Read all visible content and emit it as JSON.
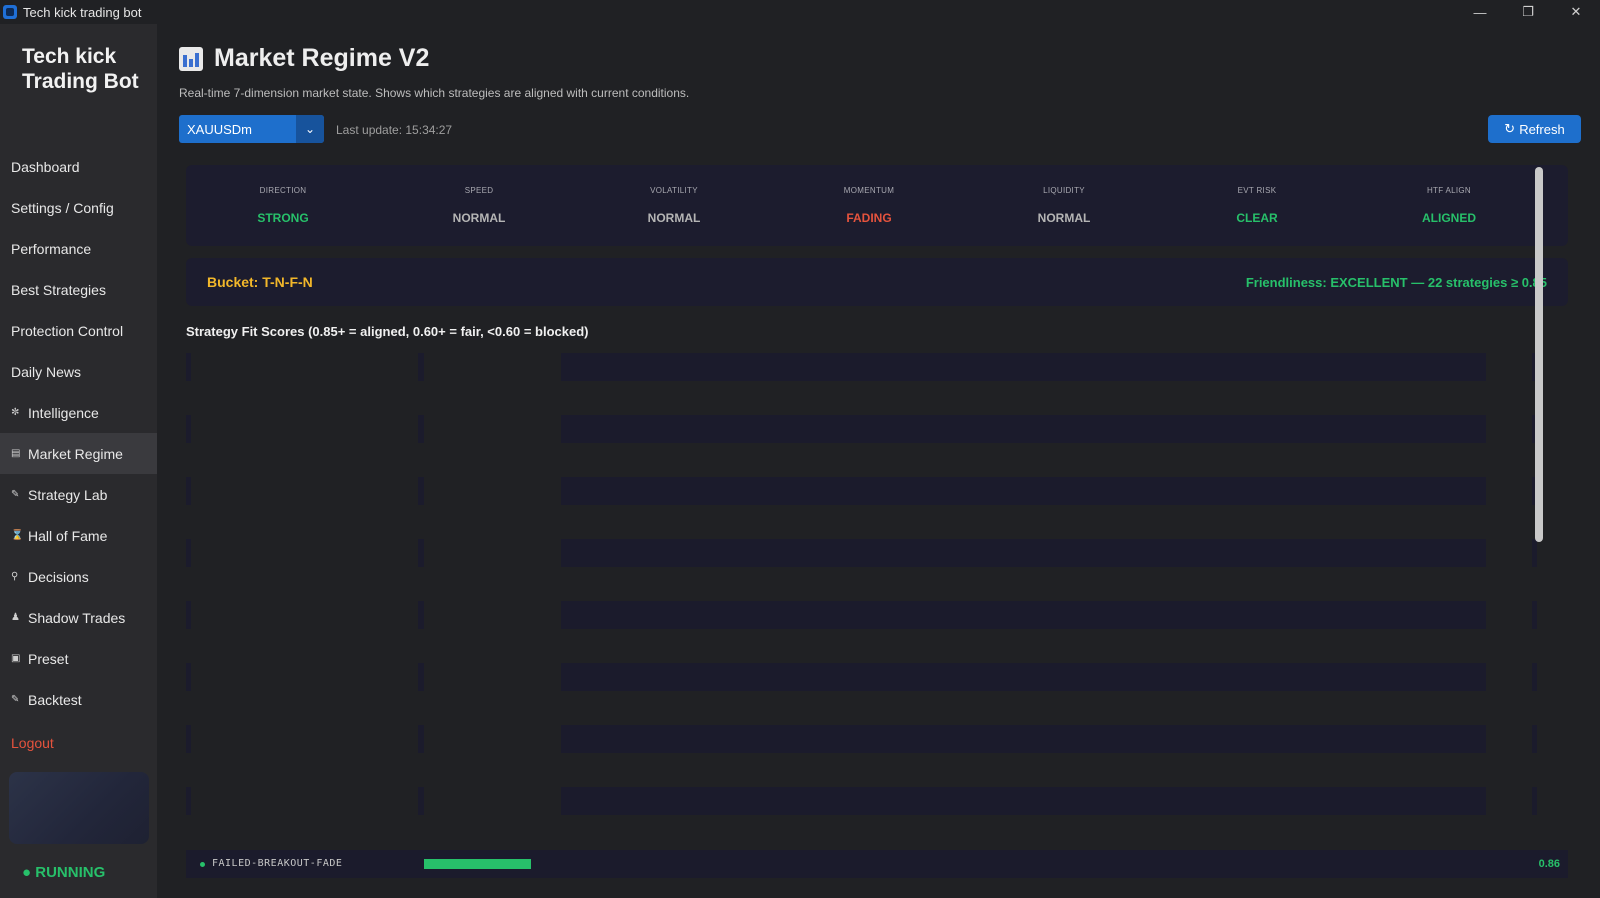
{
  "window": {
    "title": "Tech kick trading bot"
  },
  "sidebar": {
    "brand": "Tech kick Trading Bot",
    "items": [
      {
        "label": "Dashboard",
        "icon": ""
      },
      {
        "label": "Settings / Config",
        "icon": ""
      },
      {
        "label": "Performance",
        "icon": ""
      },
      {
        "label": "Best Strategies",
        "icon": ""
      },
      {
        "label": "Protection Control",
        "icon": ""
      },
      {
        "label": "Daily News",
        "icon": ""
      },
      {
        "label": "Intelligence",
        "icon": "brain-icon"
      },
      {
        "label": "Market Regime",
        "icon": "chart-icon",
        "active": true
      },
      {
        "label": "Strategy Lab",
        "icon": "pencil-icon"
      },
      {
        "label": "Hall of Fame",
        "icon": "trophy-icon"
      },
      {
        "label": "Decisions",
        "icon": "bulb-icon"
      },
      {
        "label": "Shadow Trades",
        "icon": "people-icon"
      },
      {
        "label": "Preset",
        "icon": "gift-icon"
      },
      {
        "label": "Backtest",
        "icon": "pencil-icon"
      }
    ],
    "logout": "Logout",
    "status": "RUNNING"
  },
  "header": {
    "title": "Market Regime V2",
    "subtitle": "Real-time 7-dimension market state. Shows which strategies are aligned with current conditions.",
    "symbol": "XAUUSDm",
    "last_update": "Last update: 15:34:27",
    "refresh_label": "Refresh"
  },
  "dimensions": [
    {
      "label": "DIRECTION",
      "value": "STRONG",
      "color": "#27c06a"
    },
    {
      "label": "SPEED",
      "value": "NORMAL",
      "color": "#b5b5b5"
    },
    {
      "label": "VOLATILITY",
      "value": "NORMAL",
      "color": "#b5b5b5"
    },
    {
      "label": "MOMENTUM",
      "value": "FADING",
      "color": "#e5533d"
    },
    {
      "label": "LIQUIDITY",
      "value": "NORMAL",
      "color": "#b5b5b5"
    },
    {
      "label": "EVT RISK",
      "value": "CLEAR",
      "color": "#27c06a"
    },
    {
      "label": "HTF ALIGN",
      "value": "ALIGNED",
      "color": "#27c06a"
    }
  ],
  "bucket": {
    "label": "Bucket: T-N-F-N",
    "friendliness": "Friendliness: EXCELLENT — 22 strategies ≥ 0.85"
  },
  "fit_title": "Strategy Fit Scores (0.85+ = aligned, 0.60+ = fair, <0.60 = blocked)",
  "strategy_rows": [
    {
      "name": "FAILED-BREAKOUT-FADE",
      "score": "0.86",
      "fill": 0.1
    }
  ],
  "colors": {
    "accent": "#1e6fcc",
    "good": "#27c06a",
    "bad": "#e5533d",
    "warn": "#f2b72a",
    "panel": "#1c1c2e"
  }
}
